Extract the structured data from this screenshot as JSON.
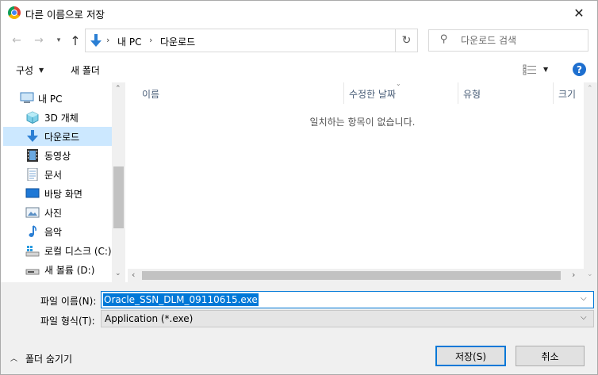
{
  "window": {
    "title": "다른 이름으로 저장",
    "close_glyph": "✕"
  },
  "address": {
    "breadcrumbs": [
      "내 PC",
      "다운로드"
    ],
    "separator": "›",
    "search_placeholder": "다운로드 검색"
  },
  "toolbar": {
    "organize_label": "구성",
    "new_folder_label": "새 폴더",
    "help_glyph": "?"
  },
  "nav": {
    "items": [
      {
        "label": "내 PC",
        "icon": "computer-icon"
      },
      {
        "label": "3D 개체",
        "icon": "3d-objects-icon"
      },
      {
        "label": "다운로드",
        "icon": "download-arrow-icon",
        "selected": true
      },
      {
        "label": "동영상",
        "icon": "video-film-icon"
      },
      {
        "label": "문서",
        "icon": "document-icon"
      },
      {
        "label": "바탕 화면",
        "icon": "desktop-icon"
      },
      {
        "label": "사진",
        "icon": "pictures-icon"
      },
      {
        "label": "음악",
        "icon": "music-note-icon"
      },
      {
        "label": "로컬 디스크 (C:)",
        "icon": "windows-drive-icon"
      },
      {
        "label": "새 볼륨 (D:)",
        "icon": "drive-icon"
      }
    ]
  },
  "file_list": {
    "columns": [
      "이름",
      "수정한 날짜",
      "유형",
      "크기"
    ],
    "empty_message": "일치하는 항목이 없습니다."
  },
  "form": {
    "filename_label": "파일 이름(N):",
    "filename_value": "Oracle_SSN_DLM_09110615.exe",
    "filetype_label": "파일 형식(T):",
    "filetype_value": "Application (*.exe)",
    "hide_folders_label": "폴더 숨기기",
    "save_label": "저장(S)",
    "cancel_label": "취소"
  },
  "colors": {
    "accent": "#0078d7",
    "selection": "#cce8ff",
    "folder_blue": "#1e6fcf"
  }
}
